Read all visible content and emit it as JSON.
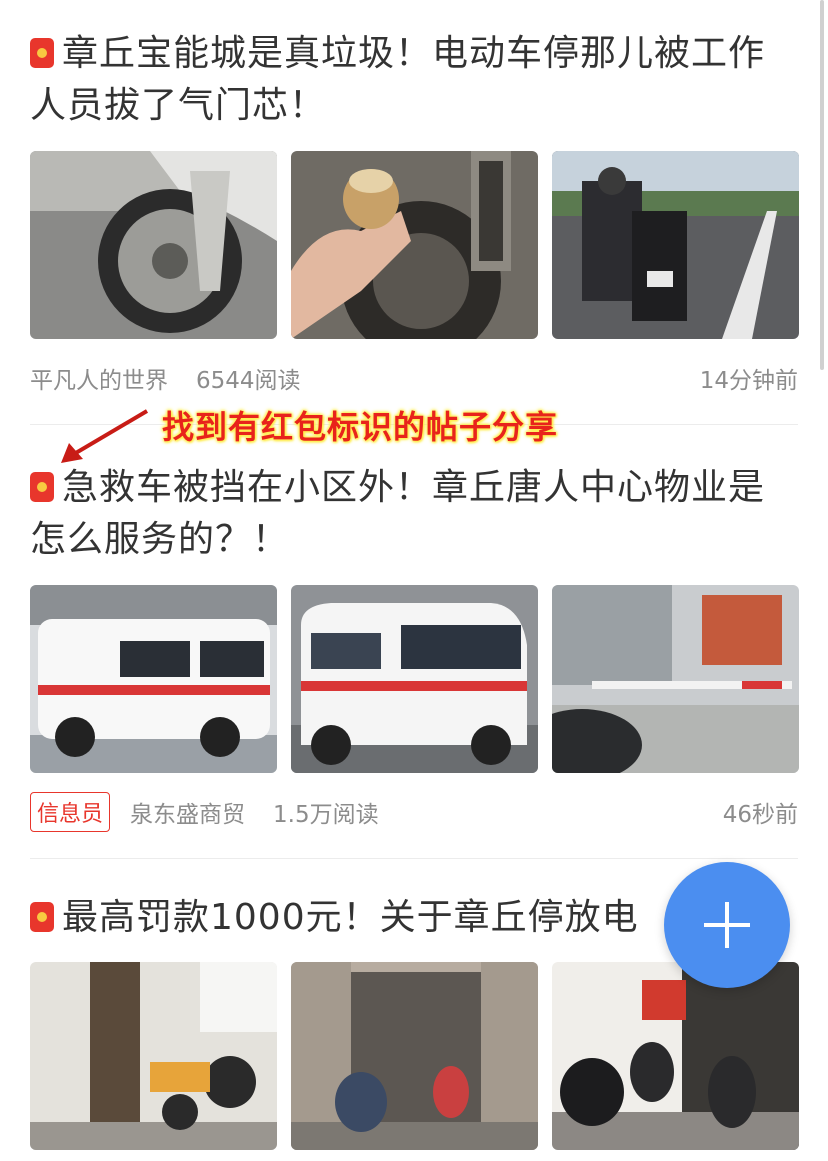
{
  "posts": [
    {
      "title": "章丘宝能城是真垃圾！电动车停那儿被工作人员拔了气门芯！",
      "author": "平凡人的世界",
      "reads": "6544阅读",
      "time": "14分钟前"
    },
    {
      "title": "急救车被挡在小区外！章丘唐人中心物业是怎么服务的？！",
      "badge": "信息员",
      "author": "泉东盛商贸",
      "reads": "1.5万阅读",
      "time": "46秒前"
    },
    {
      "title": "最高罚款1000元！关于章丘停放电"
    }
  ],
  "annotation": {
    "text": "找到有红包标识的帖子分享"
  },
  "colors": {
    "accent_red": "#e8362c",
    "fab_blue": "#4b8ef0",
    "meta_gray": "#8c8c8c"
  },
  "icons": {
    "redpacket": "red-packet-icon",
    "fab": "plus-icon"
  }
}
